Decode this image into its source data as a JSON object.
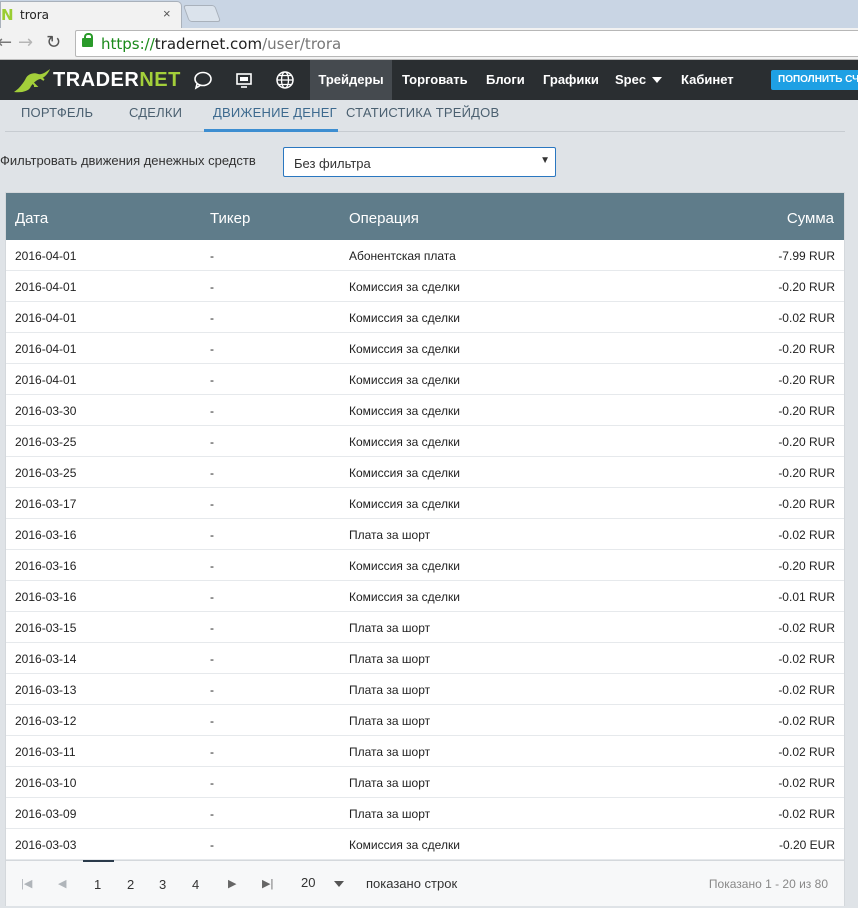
{
  "browser": {
    "tab_favicon": "N",
    "tab_title": "trora",
    "tab_close": "×",
    "url_scheme": "https://",
    "url_host": "tradernet.com",
    "url_path": "/user/trora"
  },
  "header": {
    "logo_main": "TRADER",
    "logo_accent": "NET",
    "icons": [
      "chat-icon",
      "monitor-icon",
      "globe-icon"
    ],
    "menu": [
      {
        "label": "Трейдеры"
      },
      {
        "label": "Торговать"
      },
      {
        "label": "Блоги"
      },
      {
        "label": "Графики"
      },
      {
        "label": "Spec"
      },
      {
        "label": "Кабинет"
      }
    ],
    "topup_label": "ПОПОЛНИТЬ СЧЕТ",
    "accent_color": "#a3cf3a",
    "button_color": "#1ea0e4"
  },
  "subtabs": [
    {
      "label": "ПОРТФЕЛЬ"
    },
    {
      "label": "СДЕЛКИ"
    },
    {
      "label": "ДВИЖЕНИЕ ДЕНЕГ"
    },
    {
      "label": "СТАТИСТИКА ТРЕЙДОВ"
    }
  ],
  "filter": {
    "label": "Фильтровать движения денежных средств",
    "value": "Без фильтра"
  },
  "table": {
    "columns": [
      "Дата",
      "Тикер",
      "Операция",
      "Сумма"
    ],
    "rows": [
      [
        "2016-04-01",
        "-",
        "Абонентская плата",
        "-7.99 RUR"
      ],
      [
        "2016-04-01",
        "-",
        "Комиссия за сделки",
        "-0.20 RUR"
      ],
      [
        "2016-04-01",
        "-",
        "Комиссия за сделки",
        "-0.02 RUR"
      ],
      [
        "2016-04-01",
        "-",
        "Комиссия за сделки",
        "-0.20 RUR"
      ],
      [
        "2016-04-01",
        "-",
        "Комиссия за сделки",
        "-0.20 RUR"
      ],
      [
        "2016-03-30",
        "-",
        "Комиссия за сделки",
        "-0.20 RUR"
      ],
      [
        "2016-03-25",
        "-",
        "Комиссия за сделки",
        "-0.20 RUR"
      ],
      [
        "2016-03-25",
        "-",
        "Комиссия за сделки",
        "-0.20 RUR"
      ],
      [
        "2016-03-17",
        "-",
        "Комиссия за сделки",
        "-0.20 RUR"
      ],
      [
        "2016-03-16",
        "-",
        "Плата за шорт",
        "-0.02 RUR"
      ],
      [
        "2016-03-16",
        "-",
        "Комиссия за сделки",
        "-0.20 RUR"
      ],
      [
        "2016-03-16",
        "-",
        "Комиссия за сделки",
        "-0.01 RUR"
      ],
      [
        "2016-03-15",
        "-",
        "Плата за шорт",
        "-0.02 RUR"
      ],
      [
        "2016-03-14",
        "-",
        "Плата за шорт",
        "-0.02 RUR"
      ],
      [
        "2016-03-13",
        "-",
        "Плата за шорт",
        "-0.02 RUR"
      ],
      [
        "2016-03-12",
        "-",
        "Плата за шорт",
        "-0.02 RUR"
      ],
      [
        "2016-03-11",
        "-",
        "Плата за шорт",
        "-0.02 RUR"
      ],
      [
        "2016-03-10",
        "-",
        "Плата за шорт",
        "-0.02 RUR"
      ],
      [
        "2016-03-09",
        "-",
        "Плата за шорт",
        "-0.02 RUR"
      ],
      [
        "2016-03-03",
        "-",
        "Комиссия за сделки",
        "-0.20 EUR"
      ]
    ],
    "header_color": "#5f7c8a"
  },
  "pager": {
    "pages": [
      "1",
      "2",
      "3",
      "4"
    ],
    "current_page": "1",
    "page_size": "20",
    "rows_label": "показано строк",
    "info": "Показано 1 - 20 из 80"
  }
}
